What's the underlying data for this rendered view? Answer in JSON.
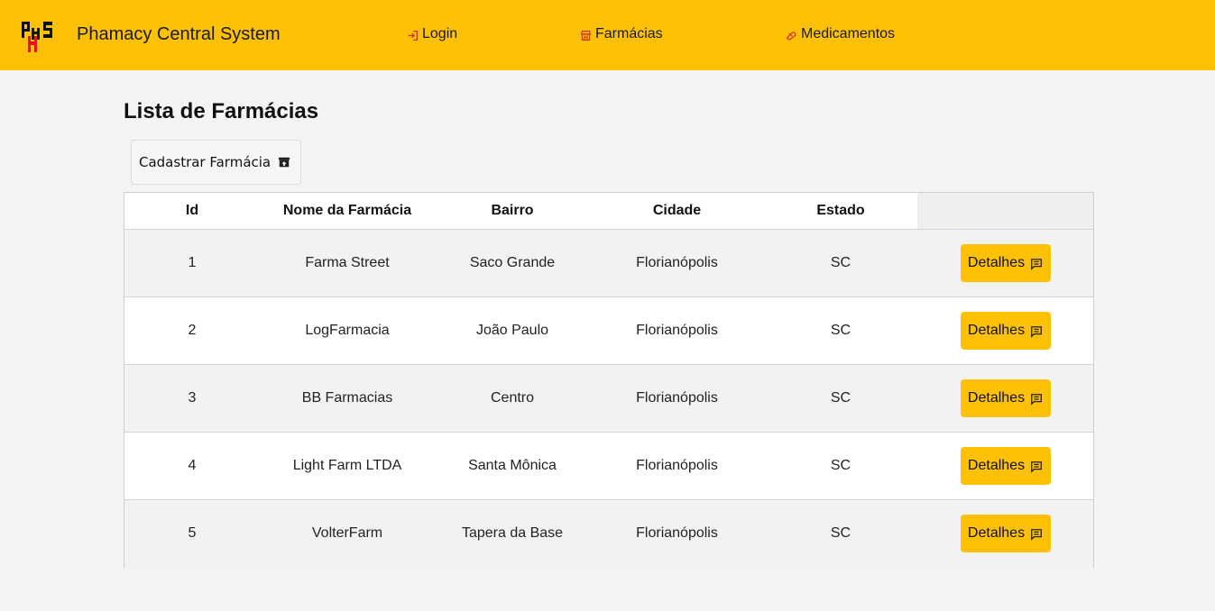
{
  "header": {
    "logo_text": "PHS",
    "brand": "Phamacy Central System",
    "nav": [
      {
        "label": "Login",
        "icon": "login-icon"
      },
      {
        "label": "Farmácias",
        "icon": "store-icon"
      },
      {
        "label": "Medicamentos",
        "icon": "pill-icon"
      }
    ],
    "accent_color": "#ffc107"
  },
  "main": {
    "title": "Lista de Farmácias",
    "register_label": "Cadastrar Farmácia",
    "register_icon": "archive-upload-icon",
    "table": {
      "columns": [
        "Id",
        "Nome da Farmácia",
        "Bairro",
        "Cidade",
        "Estado"
      ],
      "details_label": "Detalhes",
      "details_icon": "comment-icon",
      "rows": [
        {
          "id": "1",
          "name": "Farma Street",
          "bairro": "Saco Grande",
          "cidade": "Florianópolis",
          "estado": "SC"
        },
        {
          "id": "2",
          "name": "LogFarmacia",
          "bairro": "João Paulo",
          "cidade": "Florianópolis",
          "estado": "SC"
        },
        {
          "id": "3",
          "name": "BB Farmacias",
          "bairro": "Centro",
          "cidade": "Florianópolis",
          "estado": "SC"
        },
        {
          "id": "4",
          "name": "Light Farm LTDA",
          "bairro": "Santa Mônica",
          "cidade": "Florianópolis",
          "estado": "SC"
        },
        {
          "id": "5",
          "name": "VolterFarm",
          "bairro": "Tapera da Base",
          "cidade": "Florianópolis",
          "estado": "SC"
        }
      ]
    }
  }
}
